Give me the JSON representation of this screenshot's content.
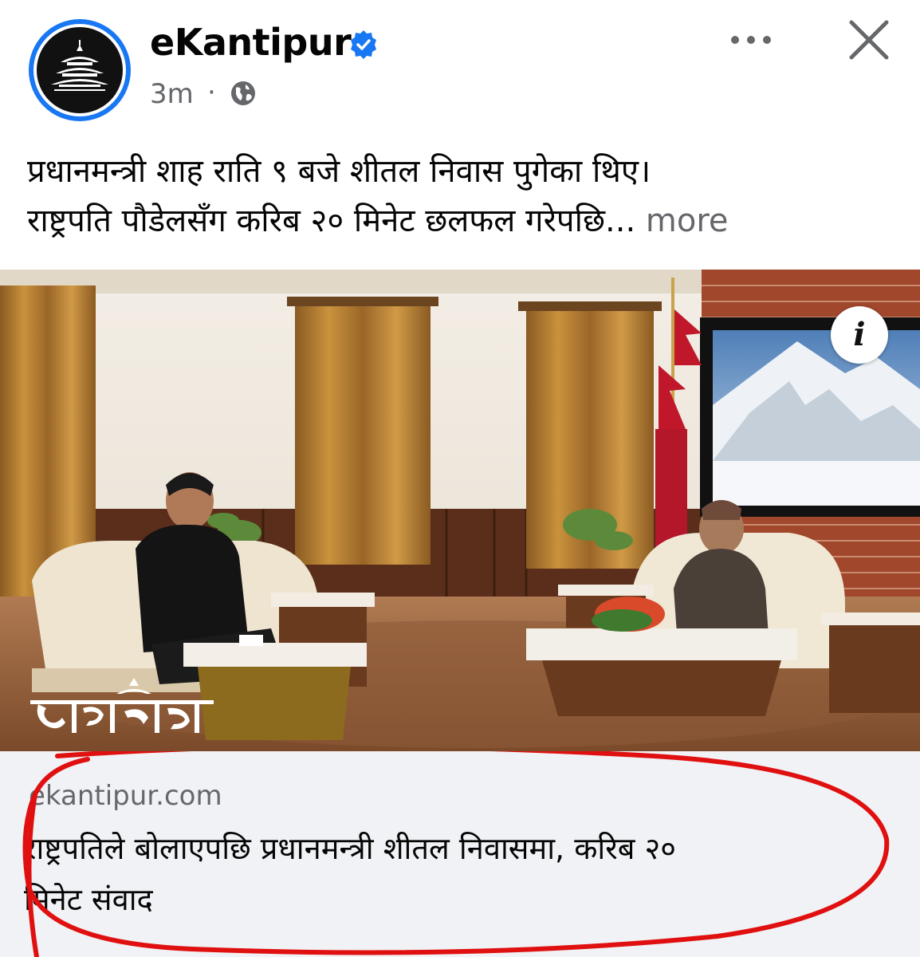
{
  "post": {
    "page_name": "eKantipur",
    "time": "3m",
    "separator": "·",
    "caption_line1": "प्रधानमन्त्री शाह राति ९ बजे शीतल निवास पुगेका थिए।",
    "caption_line2": "राष्ट्रपति पौडेलसँग करिब २० मिनेट छलफल गरेपछि...",
    "see_more": "more"
  },
  "photo": {
    "info_label": "i",
    "watermark_text": "कान्तिपुर"
  },
  "link": {
    "domain": "ekantipur.com",
    "title_line1": "राष्ट्रपतिले बोलाएपछि प्रधानमन्त्री शीतल निवासमा, करिब २०",
    "title_line2": "मिनेट संवाद"
  },
  "icons": {
    "verified": "verified-badge-icon",
    "audience": "globe-icon",
    "options": "more-options-icon",
    "close": "close-icon"
  },
  "colors": {
    "brand_blue": "#1877f2",
    "secondary_text": "#65676b",
    "annotation_red": "#e01010",
    "link_card_bg": "#f0f2f5"
  }
}
